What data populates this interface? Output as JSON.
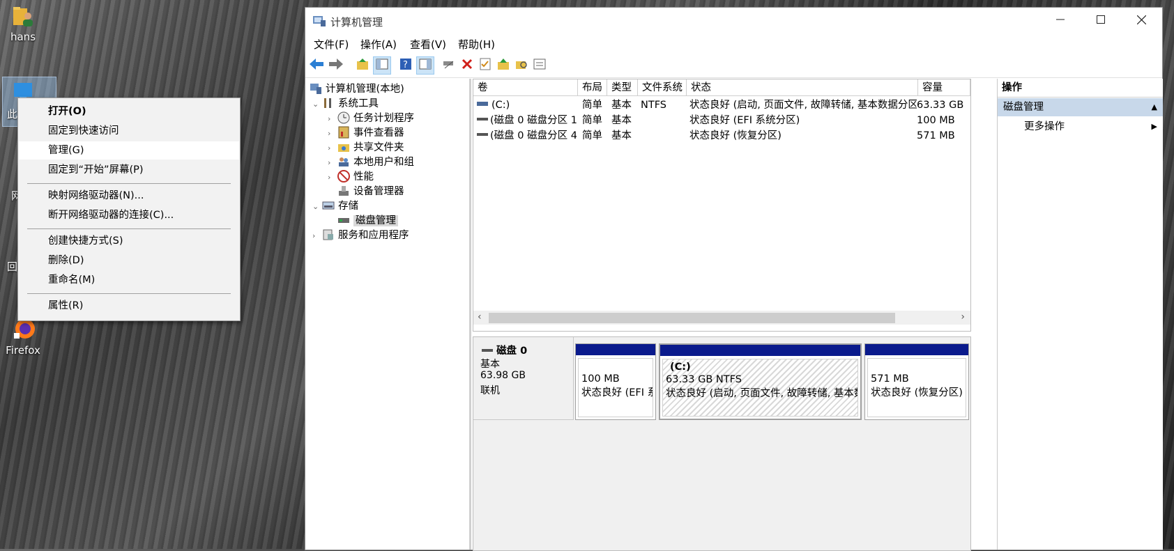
{
  "desktop": {
    "icons": [
      {
        "label": "hans"
      },
      {
        "label": "此"
      },
      {
        "label": "网"
      },
      {
        "label": "回"
      },
      {
        "label": "Firefox"
      }
    ]
  },
  "context_menu": {
    "items": [
      {
        "label": "打开(O)",
        "bold": true
      },
      {
        "label": "固定到快速访问"
      },
      {
        "label": "管理(G)",
        "hover": true
      },
      {
        "label": "固定到“开始”屏幕(P)"
      },
      {
        "label": "映射网络驱动器(N)..."
      },
      {
        "label": "断开网络驱动器的连接(C)..."
      },
      {
        "label": "创建快捷方式(S)"
      },
      {
        "label": "删除(D)"
      },
      {
        "label": "重命名(M)"
      },
      {
        "label": "属性(R)"
      }
    ]
  },
  "window": {
    "title": "计算机管理",
    "menu": [
      "文件(F)",
      "操作(A)",
      "查看(V)",
      "帮助(H)"
    ],
    "toolbar_icons": [
      "back-arrow-icon",
      "forward-arrow-icon",
      "up-folder-icon",
      "show-hide-console-tree-icon",
      "help-icon",
      "show-hide-action-pane-icon",
      "connect-drive-icon",
      "delete-icon",
      "checklist-icon",
      "folder-up-icon",
      "search-folder-icon",
      "properties-icon"
    ]
  },
  "tree": {
    "root": "计算机管理(本地)",
    "system_tools": "系统工具",
    "task_scheduler": "任务计划程序",
    "event_viewer": "事件查看器",
    "shared_folders": "共享文件夹",
    "local_users": "本地用户和组",
    "performance": "性能",
    "device_manager": "设备管理器",
    "storage": "存储",
    "disk_management": "磁盘管理",
    "services_apps": "服务和应用程序"
  },
  "volumes": {
    "columns": [
      "卷",
      "布局",
      "类型",
      "文件系统",
      "状态",
      "容量"
    ],
    "rows": [
      {
        "volume": "(C:)",
        "layout": "简单",
        "type": "基本",
        "fs": "NTFS",
        "status": "状态良好 (启动, 页面文件, 故障转储, 基本数据分区)",
        "capacity": "63.33 GB"
      },
      {
        "volume": "(磁盘 0 磁盘分区 1)",
        "layout": "简单",
        "type": "基本",
        "fs": "",
        "status": "状态良好 (EFI 系统分区)",
        "capacity": "100 MB"
      },
      {
        "volume": "(磁盘 0 磁盘分区 4)",
        "layout": "简单",
        "type": "基本",
        "fs": "",
        "status": "状态良好 (恢复分区)",
        "capacity": "571 MB"
      }
    ]
  },
  "disk": {
    "name": "磁盘 0",
    "type": "基本",
    "size": "63.98 GB",
    "state": "联机",
    "partitions": [
      {
        "title": "",
        "size": "100 MB",
        "status": "状态良好 (EFI 系统分区)"
      },
      {
        "title": "(C:)",
        "size": "63.33 GB NTFS",
        "status": "状态良好 (启动, 页面文件, 故障转储, 基本数据分区)"
      },
      {
        "title": "",
        "size": "571 MB",
        "status": "状态良好 (恢复分区)"
      }
    ]
  },
  "actions": {
    "header": "操作",
    "section": "磁盘管理",
    "more": "更多操作"
  },
  "colors": {
    "partition_band": "#0a1a8c",
    "action_section": "#c8d8ea"
  }
}
